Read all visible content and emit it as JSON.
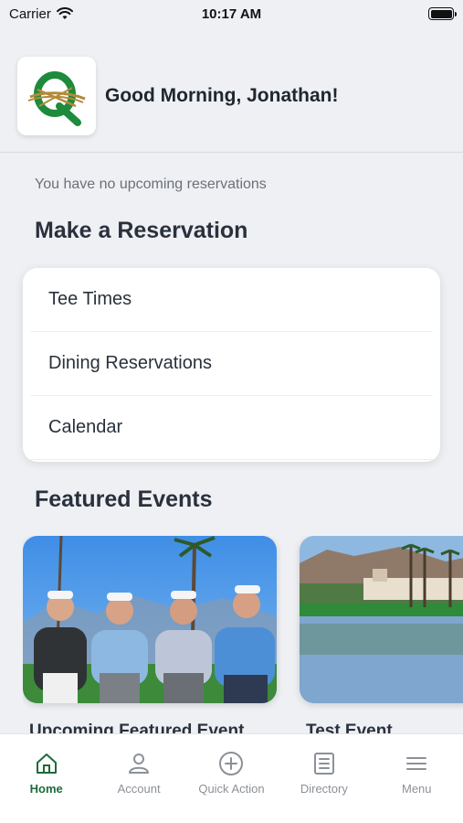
{
  "status_bar": {
    "carrier": "Carrier",
    "time": "10:17 AM"
  },
  "header": {
    "greeting": "Good Morning, Jonathan!",
    "logo_colors": {
      "green": "#1e8a3c",
      "gold": "#b38a3a"
    }
  },
  "reservations": {
    "empty_message": "You have no upcoming reservations",
    "section_title": "Make a Reservation",
    "items": [
      {
        "label": "Tee Times"
      },
      {
        "label": "Dining Reservations"
      },
      {
        "label": "Calendar"
      }
    ]
  },
  "events": {
    "section_title": "Featured Events",
    "cards": [
      {
        "title": "Upcoming Featured Event"
      },
      {
        "title": "Test Event"
      }
    ]
  },
  "tab_bar": {
    "active_color": "#1e6b3a",
    "items": [
      {
        "label": "Home",
        "icon": "home-icon",
        "active": true
      },
      {
        "label": "Account",
        "icon": "person-icon",
        "active": false
      },
      {
        "label": "Quick Action",
        "icon": "plus-circle-icon",
        "active": false
      },
      {
        "label": "Directory",
        "icon": "list-icon",
        "active": false
      },
      {
        "label": "Menu",
        "icon": "hamburger-icon",
        "active": false
      }
    ]
  }
}
